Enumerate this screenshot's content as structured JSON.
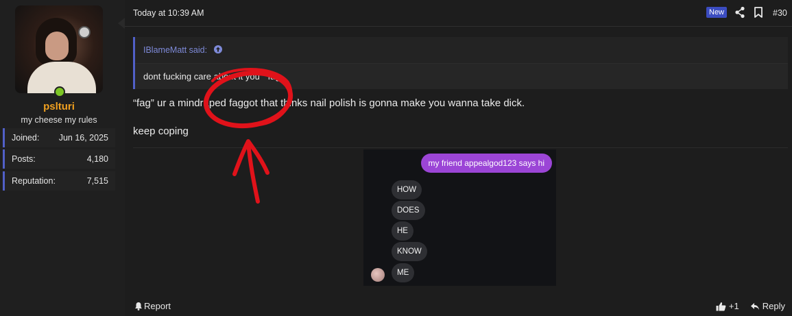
{
  "user": {
    "username": "pslturi",
    "title": "my cheese my rules",
    "stats": [
      {
        "label": "Joined:",
        "value": "Jun 16, 2025"
      },
      {
        "label": "Posts:",
        "value": "4,180"
      },
      {
        "label": "Reputation:",
        "value": "7,515"
      }
    ]
  },
  "post": {
    "timestamp": "Today at 10:39 AM",
    "new_badge": "New",
    "number": "#30",
    "quote": {
      "author": "IBlameMatt said:",
      "text": "dont fucking care about it you \" fag"
    },
    "lines": [
      "“fag” ur a mindraped faggot that thinks nail polish is gonna make you wanna take dick.",
      "keep coping"
    ],
    "chat": {
      "sent": "my friend appealgod123 says hi",
      "received": [
        "HOW",
        "DOES",
        "HE",
        "KNOW",
        "ME"
      ]
    },
    "footer": {
      "report": "Report",
      "like_count": "+1",
      "reply": "Reply"
    }
  },
  "colors": {
    "accent": "#5160c8",
    "username": "#f0a020",
    "online": "#7cc524",
    "bubble_sent": "#9b45d6",
    "annotation": "#e0121a"
  },
  "icons": [
    "share-icon",
    "bookmark-icon",
    "arrow-up-circle-icon",
    "bell-icon",
    "thumbs-up-icon",
    "reply-icon"
  ]
}
